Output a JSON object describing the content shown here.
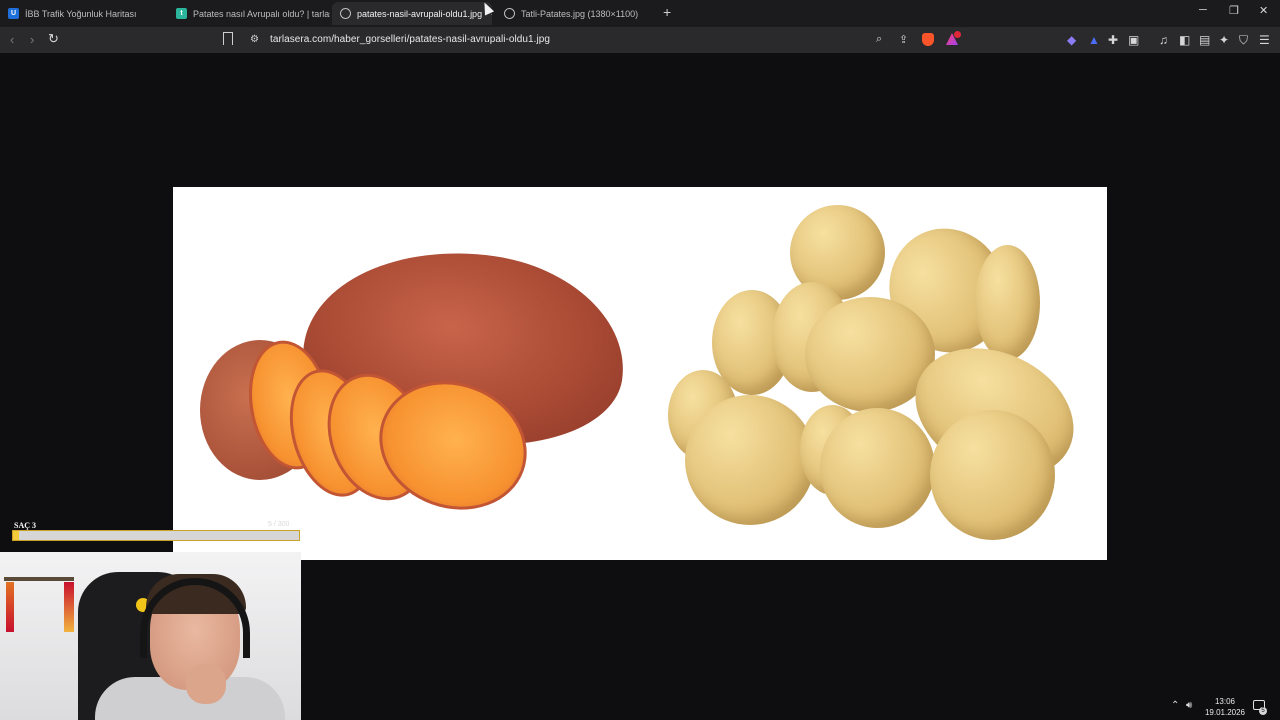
{
  "tabs": [
    {
      "title": "İBB Trafik Yoğunluk Haritası",
      "icon": "ibb-logo-icon",
      "active": false
    },
    {
      "title": "Patates nasıl Avrupalı oldu? | tarlasera",
      "icon": "tarlasera-icon",
      "active": false
    },
    {
      "title": "patates-nasil-avrupali-oldu1.jpg",
      "icon": "globe-icon",
      "active": true
    },
    {
      "title": "Tatli-Patates.jpg (1380×1100)",
      "icon": "globe-icon",
      "active": false
    }
  ],
  "toolbar": {
    "url": "tarlasera.com/haber_gorselleri/patates-nasil-avrupali-oldu1.jpg",
    "rewards_count": "1"
  },
  "viewer": {
    "image_description_alt": "patates-nasil-avrupali-oldu1.jpg"
  },
  "overlay": {
    "label": "SAÇ 3",
    "count": "5 / 300",
    "progress": 0.02
  },
  "taskbar": {
    "time": "13:06",
    "date": "19.01.2026",
    "notifications": "5"
  },
  "colors": {
    "accent_bar": "#f2cc3a",
    "brave_orange": "#fb542b"
  }
}
